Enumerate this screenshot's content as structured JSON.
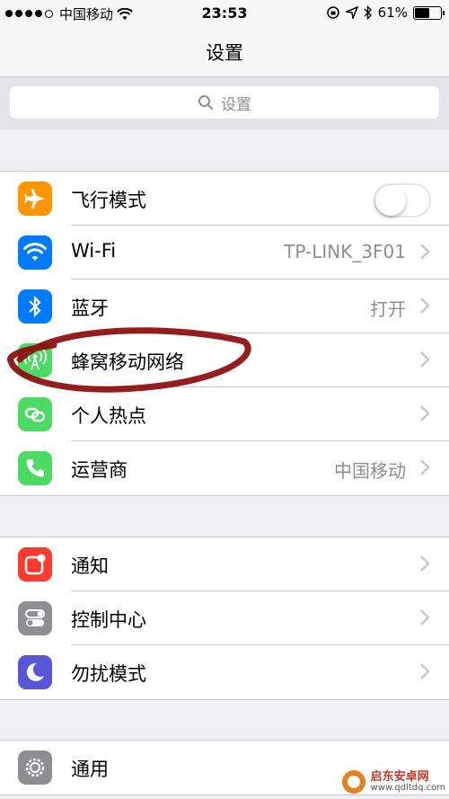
{
  "status_bar": {
    "carrier": "中国移动",
    "time": "23:53",
    "battery_text": "61%",
    "battery_level": 0.61,
    "signal_bars_filled": 4,
    "signal_bars_total": 5
  },
  "nav": {
    "title": "设置"
  },
  "search": {
    "placeholder": "设置"
  },
  "groups": [
    {
      "rows": [
        {
          "label": "飞行模式",
          "icon": "airplane-icon",
          "icon_color": "#ff9500",
          "control": "toggle",
          "toggle_on": false
        },
        {
          "label": "Wi-Fi",
          "icon": "wifi-icon",
          "icon_color": "#007aff",
          "value": "TP-LINK_3F01"
        },
        {
          "label": "蓝牙",
          "icon": "bluetooth-icon",
          "icon_color": "#007aff",
          "value": "打开"
        },
        {
          "label": "蜂窝移动网络",
          "icon": "cellular-antenna-icon",
          "icon_color": "#4cd964"
        },
        {
          "label": "个人热点",
          "icon": "personal-hotspot-icon",
          "icon_color": "#4cd964"
        },
        {
          "label": "运营商",
          "icon": "phone-icon",
          "icon_color": "#4cd964",
          "value": "中国移动"
        }
      ]
    },
    {
      "rows": [
        {
          "label": "通知",
          "icon": "notifications-icon",
          "icon_color": "#ff3b30"
        },
        {
          "label": "控制中心",
          "icon": "control-center-icon",
          "icon_color": "#8e8e93"
        },
        {
          "label": "勿扰模式",
          "icon": "moon-icon",
          "icon_color": "#5856d6"
        }
      ]
    },
    {
      "rows": [
        {
          "label": "通用",
          "icon": "gear-icon",
          "icon_color": "#8e8e93"
        }
      ]
    }
  ],
  "watermark": {
    "name": "启东安卓网",
    "url": "www.qdltdq.com"
  }
}
